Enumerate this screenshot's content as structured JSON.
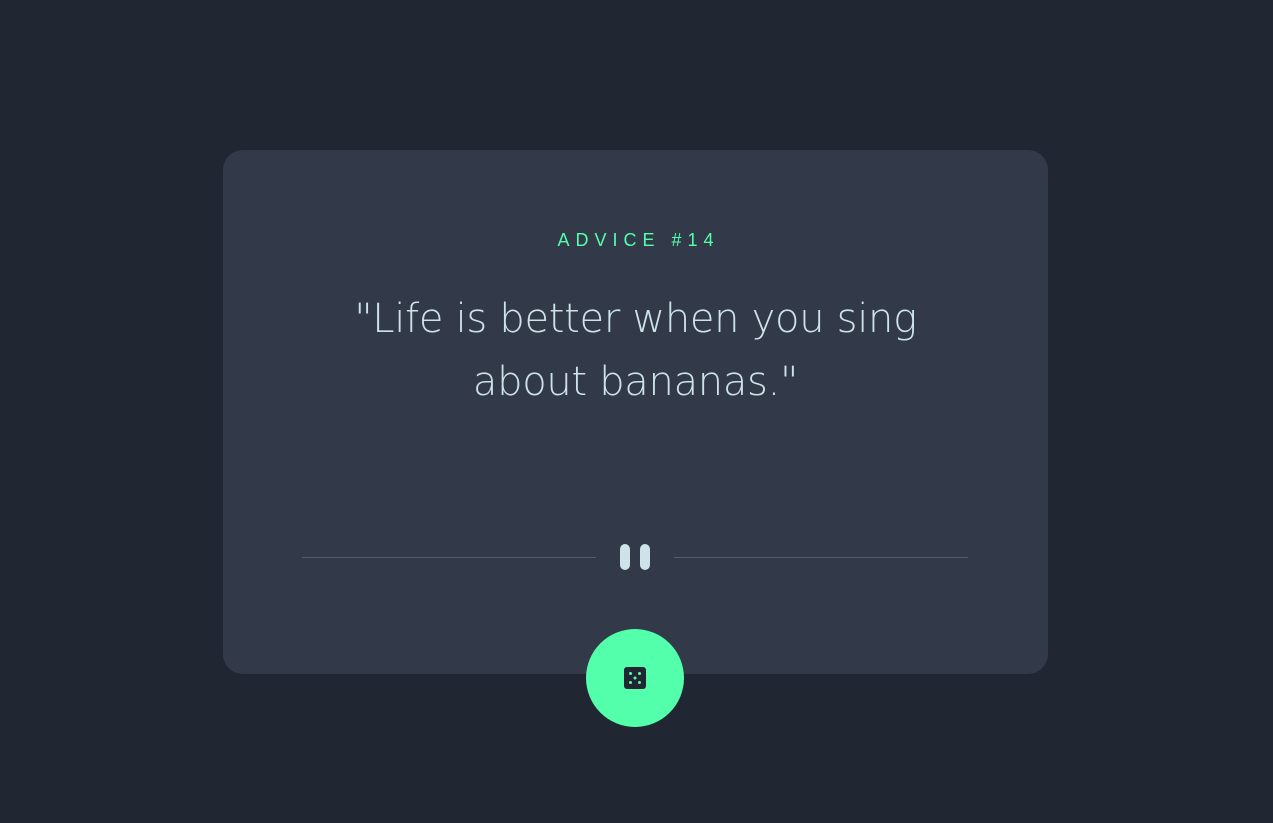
{
  "advice": {
    "id_label": "ADVICE #14",
    "quote": "\"Life is better when you sing about bananas.\""
  },
  "divider": {
    "icon": "pause-icon"
  },
  "dice_button": {
    "icon": "dice-icon",
    "color": "#53ffaa"
  },
  "colors": {
    "background": "#202632",
    "card": "#323a49",
    "accent": "#53ffaa",
    "text": "#cee3e9",
    "divider": "#4f5d74"
  }
}
